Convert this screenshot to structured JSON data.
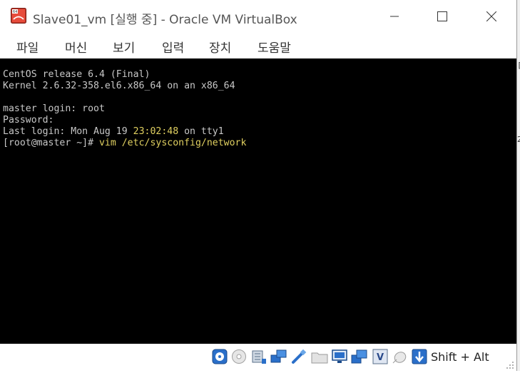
{
  "window": {
    "title": "Slave01_vm [실행 중] - Oracle VM VirtualBox",
    "app_icon": "virtualbox-64-icon",
    "controls": {
      "minimize": "minimize-icon",
      "maximize": "maximize-icon",
      "close": "close-icon"
    }
  },
  "menubar": {
    "items": [
      {
        "label": "파일"
      },
      {
        "label": "머신"
      },
      {
        "label": "보기"
      },
      {
        "label": "입력"
      },
      {
        "label": "장치"
      },
      {
        "label": "도움말"
      }
    ]
  },
  "console": {
    "line1": "CentOS release 6.4 (Final)",
    "line2": "Kernel 2.6.32-358.el6.x86_64 on an x86_64",
    "line3": "",
    "line4": "master login: root",
    "line5": "Password:",
    "line6_prefix": "Last login: Mon Aug 19 ",
    "line6_time": "23:02:48",
    "line6_suffix": " on tty1",
    "prompt": "[root@master ~]# ",
    "command": "vim /etc/sysconfig/network"
  },
  "statusbar": {
    "icons": [
      "hard-disk-icon",
      "optical-drive-icon",
      "audio-icon",
      "network-icon",
      "usb-icon",
      "shared-folders-icon",
      "display-icon",
      "video-capture-icon",
      "virtualization-icon",
      "mouse-integration-icon",
      "keyboard-capture-icon"
    ],
    "host_key": "Shift + Alt"
  },
  "colors": {
    "screen_bg": "#000000",
    "console_text": "#c8c8c8",
    "highlight_text": "#e0d060"
  }
}
